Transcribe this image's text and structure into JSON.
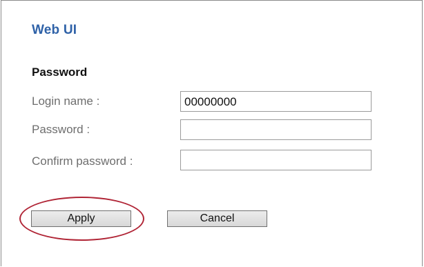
{
  "header": {
    "title": "Web UI"
  },
  "password_section": {
    "title": "Password",
    "fields": [
      {
        "label": "Login name :",
        "value": "00000000",
        "placeholder": ""
      },
      {
        "label": "Password :",
        "value": "",
        "placeholder": ""
      },
      {
        "label": "Confirm password :",
        "value": "",
        "placeholder": ""
      }
    ]
  },
  "actions": {
    "apply_label": "Apply",
    "cancel_label": "Cancel"
  },
  "colors": {
    "title": "#2f62a8",
    "highlight": "#b02435",
    "label": "#6e6e6e"
  }
}
